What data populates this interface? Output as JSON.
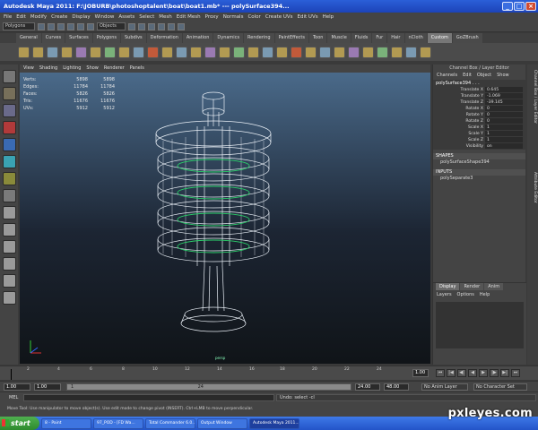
{
  "window": {
    "title": "Autodesk Maya 2011: F:\\JOBURB\\photoshoptalent\\boat\\boat1.mb* --- polySurface394..."
  },
  "menubar": [
    "File",
    "Edit",
    "Modify",
    "Create",
    "Display",
    "Window",
    "Assets",
    "Select",
    "Mesh",
    "Edit Mesh",
    "Proxy",
    "Normals",
    "Color",
    "Create UVs",
    "Edit UVs",
    "Help"
  ],
  "statusline": {
    "mode": "Polygons",
    "objects": "Objects"
  },
  "shelf_tabs": [
    {
      "label": "General"
    },
    {
      "label": "Curves"
    },
    {
      "label": "Surfaces"
    },
    {
      "label": "Polygons"
    },
    {
      "label": "Subdivs"
    },
    {
      "label": "Deformation"
    },
    {
      "label": "Animation"
    },
    {
      "label": "Dynamics"
    },
    {
      "label": "Rendering"
    },
    {
      "label": "PaintEffects"
    },
    {
      "label": "Toon"
    },
    {
      "label": "Muscle"
    },
    {
      "label": "Fluids"
    },
    {
      "label": "Fur"
    },
    {
      "label": "Hair"
    },
    {
      "label": "nCloth"
    },
    {
      "label": "Custom",
      "active": true
    },
    {
      "label": "GoZBrush"
    }
  ],
  "viewport_menu": [
    "View",
    "Shading",
    "Lighting",
    "Show",
    "Renderer",
    "Panels"
  ],
  "hud": [
    {
      "k": "Verts:",
      "a": "5898",
      "b": "5898"
    },
    {
      "k": "Edges:",
      "a": "11784",
      "b": "11784"
    },
    {
      "k": "Faces:",
      "a": "5826",
      "b": "5826"
    },
    {
      "k": "Tris:",
      "a": "11676",
      "b": "11676"
    },
    {
      "k": "UVs:",
      "a": "5912",
      "b": "5912"
    }
  ],
  "camera_label": "persp",
  "channel_box": {
    "title": "Channel Box / Layer Editor",
    "menu": [
      "Channels",
      "Edit",
      "Object",
      "Show"
    ],
    "object": "polySurface394 . . .",
    "attributes": [
      {
        "n": "Translate X",
        "v": "0.645"
      },
      {
        "n": "Translate Y",
        "v": "-1.069"
      },
      {
        "n": "Translate Z",
        "v": "-39.145"
      },
      {
        "n": "Rotate X",
        "v": "0"
      },
      {
        "n": "Rotate Y",
        "v": "0"
      },
      {
        "n": "Rotate Z",
        "v": "0"
      },
      {
        "n": "Scale X",
        "v": "1"
      },
      {
        "n": "Scale Y",
        "v": "1"
      },
      {
        "n": "Scale Z",
        "v": "1"
      },
      {
        "n": "Visibility",
        "v": "on"
      }
    ],
    "shapes_label": "SHAPES",
    "shape": "polySurfaceShape394",
    "inputs_label": "INPUTS",
    "input": "polySeparate3"
  },
  "layer_editor": {
    "tabs": [
      "Display",
      "Render",
      "Anim"
    ],
    "menu": [
      "Layers",
      "Options",
      "Help"
    ]
  },
  "vertical_tabs": [
    "Channel Box / Layer Editor",
    "Attribute Editor"
  ],
  "timeline": {
    "ticks": [
      "2",
      "4",
      "6",
      "8",
      "10",
      "12",
      "14",
      "16",
      "18",
      "20",
      "22",
      "24"
    ],
    "current_frame": "1.00"
  },
  "range": {
    "start": "1.00",
    "inner_start": "1.00",
    "bar_start": "1",
    "bar_end": "24",
    "end": "24.00",
    "anim_end": "48.00",
    "anim_layer": "No Anim Layer",
    "character_set": "No Character Set"
  },
  "cmdline": {
    "label": "MEL",
    "result": "Undo: select -cl"
  },
  "helpline": "Move Tool: Use manipulator to move object(s). Use edit mode to change pivot (INSERT). Ctrl+LMB to move perpendicular.",
  "taskbar": {
    "start": "start",
    "items": [
      {
        "label": "8 - Paint"
      },
      {
        "label": "97_POD - [FD Wa..."
      },
      {
        "label": "Total Commander 6.0..."
      },
      {
        "label": "Output Window"
      },
      {
        "label": "Autodesk Maya 2011..."
      }
    ]
  },
  "watermark": "pxleyes.com",
  "colors": {
    "maya_bg": "#444444",
    "viewport_top": "#4a6a8a",
    "viewport_bottom": "#101418",
    "xp_taskbar": "#2354c8",
    "selection_green": "#2bd06a"
  }
}
